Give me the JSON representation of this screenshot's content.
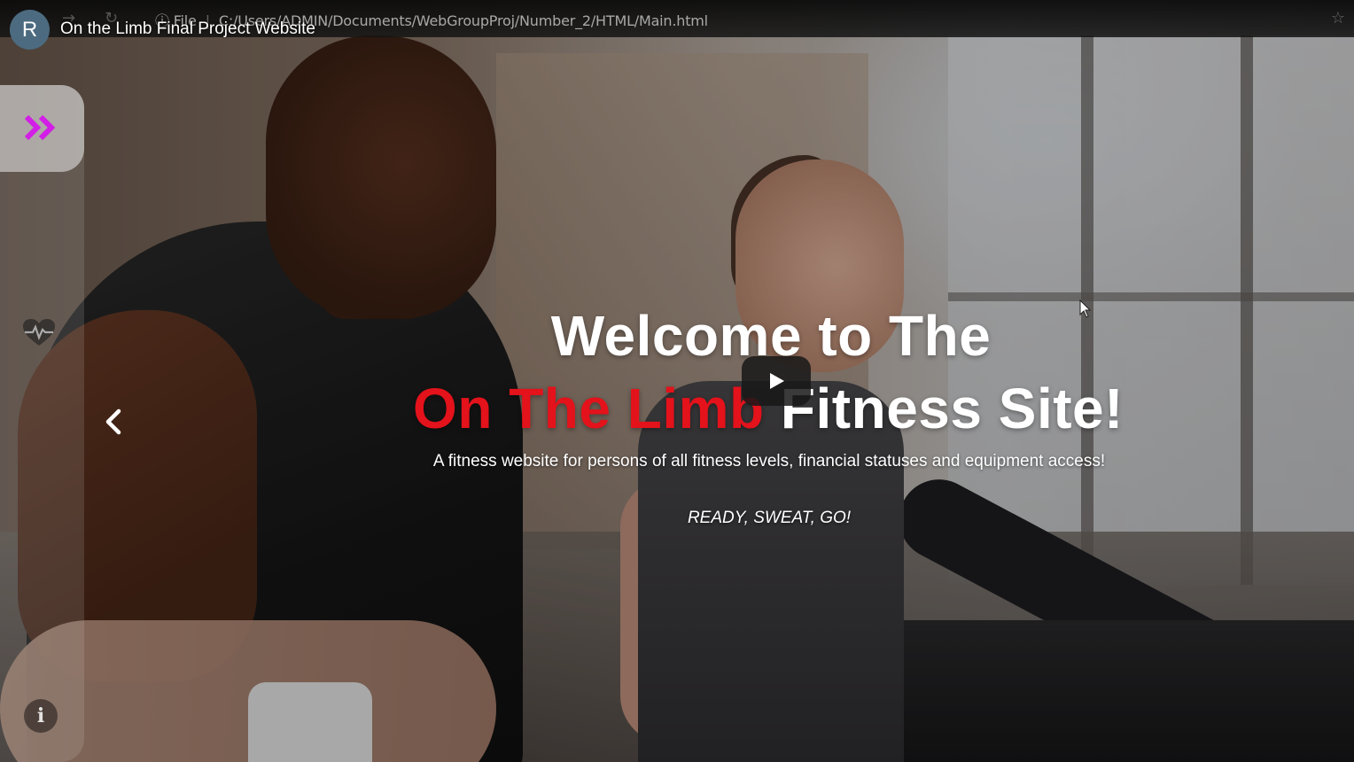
{
  "video": {
    "channel_initial": "R",
    "title": "On the Limb Final Project Website"
  },
  "browser": {
    "address_prefix": "File",
    "address_path": "C:/Users/ADMIN/Documents/WebGroupProj/Number_2/HTML/Main.html"
  },
  "hero": {
    "line1": "Welcome to The",
    "line2_red": "On The Limb",
    "line2_white": " Fitness Site!",
    "tagline": "A fitness website for persons of all fitness levels, financial statuses and equipment access!",
    "slogan": "READY, SWEAT, GO!"
  },
  "colors": {
    "brand_red": "#e3121b",
    "accent_magenta": "#d21ee6",
    "avatar_bg": "#4c6b80"
  },
  "icons": {
    "sidebar_toggle": "double-chevron-right-icon",
    "sidebar_heart": "heartbeat-icon",
    "sidebar_info": "info-icon",
    "carousel_prev": "chevron-left-icon",
    "video_play": "play-icon",
    "bookmark": "star-icon"
  }
}
